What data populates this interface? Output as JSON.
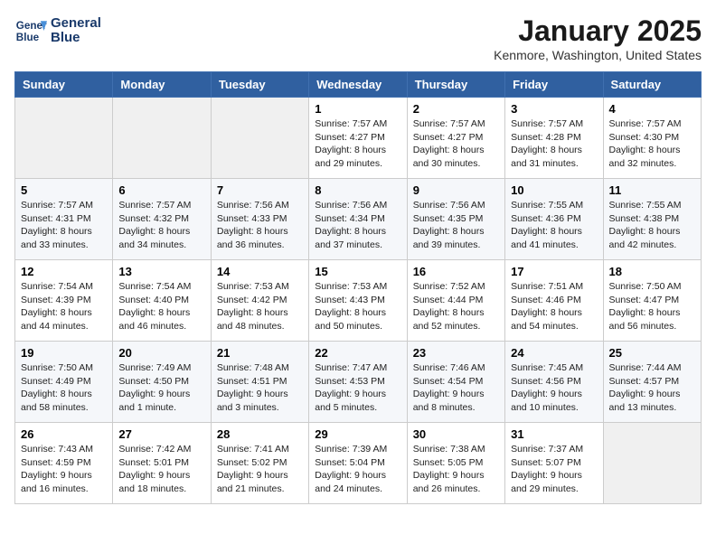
{
  "header": {
    "logo_line1": "General",
    "logo_line2": "Blue",
    "month": "January 2025",
    "location": "Kenmore, Washington, United States"
  },
  "weekdays": [
    "Sunday",
    "Monday",
    "Tuesday",
    "Wednesday",
    "Thursday",
    "Friday",
    "Saturday"
  ],
  "weeks": [
    [
      {
        "day": "",
        "sunrise": "",
        "sunset": "",
        "daylight": ""
      },
      {
        "day": "",
        "sunrise": "",
        "sunset": "",
        "daylight": ""
      },
      {
        "day": "",
        "sunrise": "",
        "sunset": "",
        "daylight": ""
      },
      {
        "day": "1",
        "sunrise": "Sunrise: 7:57 AM",
        "sunset": "Sunset: 4:27 PM",
        "daylight": "Daylight: 8 hours and 29 minutes."
      },
      {
        "day": "2",
        "sunrise": "Sunrise: 7:57 AM",
        "sunset": "Sunset: 4:27 PM",
        "daylight": "Daylight: 8 hours and 30 minutes."
      },
      {
        "day": "3",
        "sunrise": "Sunrise: 7:57 AM",
        "sunset": "Sunset: 4:28 PM",
        "daylight": "Daylight: 8 hours and 31 minutes."
      },
      {
        "day": "4",
        "sunrise": "Sunrise: 7:57 AM",
        "sunset": "Sunset: 4:30 PM",
        "daylight": "Daylight: 8 hours and 32 minutes."
      }
    ],
    [
      {
        "day": "5",
        "sunrise": "Sunrise: 7:57 AM",
        "sunset": "Sunset: 4:31 PM",
        "daylight": "Daylight: 8 hours and 33 minutes."
      },
      {
        "day": "6",
        "sunrise": "Sunrise: 7:57 AM",
        "sunset": "Sunset: 4:32 PM",
        "daylight": "Daylight: 8 hours and 34 minutes."
      },
      {
        "day": "7",
        "sunrise": "Sunrise: 7:56 AM",
        "sunset": "Sunset: 4:33 PM",
        "daylight": "Daylight: 8 hours and 36 minutes."
      },
      {
        "day": "8",
        "sunrise": "Sunrise: 7:56 AM",
        "sunset": "Sunset: 4:34 PM",
        "daylight": "Daylight: 8 hours and 37 minutes."
      },
      {
        "day": "9",
        "sunrise": "Sunrise: 7:56 AM",
        "sunset": "Sunset: 4:35 PM",
        "daylight": "Daylight: 8 hours and 39 minutes."
      },
      {
        "day": "10",
        "sunrise": "Sunrise: 7:55 AM",
        "sunset": "Sunset: 4:36 PM",
        "daylight": "Daylight: 8 hours and 41 minutes."
      },
      {
        "day": "11",
        "sunrise": "Sunrise: 7:55 AM",
        "sunset": "Sunset: 4:38 PM",
        "daylight": "Daylight: 8 hours and 42 minutes."
      }
    ],
    [
      {
        "day": "12",
        "sunrise": "Sunrise: 7:54 AM",
        "sunset": "Sunset: 4:39 PM",
        "daylight": "Daylight: 8 hours and 44 minutes."
      },
      {
        "day": "13",
        "sunrise": "Sunrise: 7:54 AM",
        "sunset": "Sunset: 4:40 PM",
        "daylight": "Daylight: 8 hours and 46 minutes."
      },
      {
        "day": "14",
        "sunrise": "Sunrise: 7:53 AM",
        "sunset": "Sunset: 4:42 PM",
        "daylight": "Daylight: 8 hours and 48 minutes."
      },
      {
        "day": "15",
        "sunrise": "Sunrise: 7:53 AM",
        "sunset": "Sunset: 4:43 PM",
        "daylight": "Daylight: 8 hours and 50 minutes."
      },
      {
        "day": "16",
        "sunrise": "Sunrise: 7:52 AM",
        "sunset": "Sunset: 4:44 PM",
        "daylight": "Daylight: 8 hours and 52 minutes."
      },
      {
        "day": "17",
        "sunrise": "Sunrise: 7:51 AM",
        "sunset": "Sunset: 4:46 PM",
        "daylight": "Daylight: 8 hours and 54 minutes."
      },
      {
        "day": "18",
        "sunrise": "Sunrise: 7:50 AM",
        "sunset": "Sunset: 4:47 PM",
        "daylight": "Daylight: 8 hours and 56 minutes."
      }
    ],
    [
      {
        "day": "19",
        "sunrise": "Sunrise: 7:50 AM",
        "sunset": "Sunset: 4:49 PM",
        "daylight": "Daylight: 8 hours and 58 minutes."
      },
      {
        "day": "20",
        "sunrise": "Sunrise: 7:49 AM",
        "sunset": "Sunset: 4:50 PM",
        "daylight": "Daylight: 9 hours and 1 minute."
      },
      {
        "day": "21",
        "sunrise": "Sunrise: 7:48 AM",
        "sunset": "Sunset: 4:51 PM",
        "daylight": "Daylight: 9 hours and 3 minutes."
      },
      {
        "day": "22",
        "sunrise": "Sunrise: 7:47 AM",
        "sunset": "Sunset: 4:53 PM",
        "daylight": "Daylight: 9 hours and 5 minutes."
      },
      {
        "day": "23",
        "sunrise": "Sunrise: 7:46 AM",
        "sunset": "Sunset: 4:54 PM",
        "daylight": "Daylight: 9 hours and 8 minutes."
      },
      {
        "day": "24",
        "sunrise": "Sunrise: 7:45 AM",
        "sunset": "Sunset: 4:56 PM",
        "daylight": "Daylight: 9 hours and 10 minutes."
      },
      {
        "day": "25",
        "sunrise": "Sunrise: 7:44 AM",
        "sunset": "Sunset: 4:57 PM",
        "daylight": "Daylight: 9 hours and 13 minutes."
      }
    ],
    [
      {
        "day": "26",
        "sunrise": "Sunrise: 7:43 AM",
        "sunset": "Sunset: 4:59 PM",
        "daylight": "Daylight: 9 hours and 16 minutes."
      },
      {
        "day": "27",
        "sunrise": "Sunrise: 7:42 AM",
        "sunset": "Sunset: 5:01 PM",
        "daylight": "Daylight: 9 hours and 18 minutes."
      },
      {
        "day": "28",
        "sunrise": "Sunrise: 7:41 AM",
        "sunset": "Sunset: 5:02 PM",
        "daylight": "Daylight: 9 hours and 21 minutes."
      },
      {
        "day": "29",
        "sunrise": "Sunrise: 7:39 AM",
        "sunset": "Sunset: 5:04 PM",
        "daylight": "Daylight: 9 hours and 24 minutes."
      },
      {
        "day": "30",
        "sunrise": "Sunrise: 7:38 AM",
        "sunset": "Sunset: 5:05 PM",
        "daylight": "Daylight: 9 hours and 26 minutes."
      },
      {
        "day": "31",
        "sunrise": "Sunrise: 7:37 AM",
        "sunset": "Sunset: 5:07 PM",
        "daylight": "Daylight: 9 hours and 29 minutes."
      },
      {
        "day": "",
        "sunrise": "",
        "sunset": "",
        "daylight": ""
      }
    ]
  ]
}
